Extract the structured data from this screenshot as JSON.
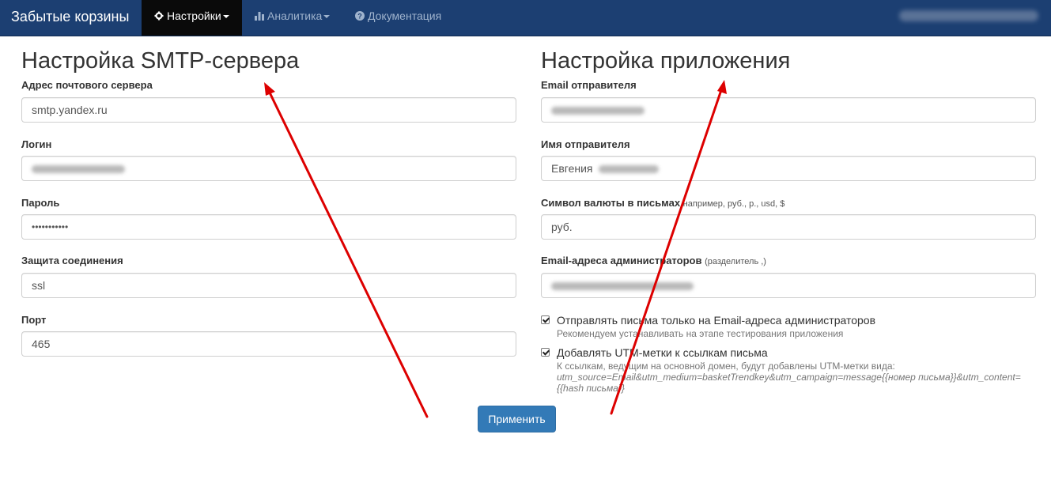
{
  "navbar": {
    "brand": "Забытые корзины",
    "items": [
      {
        "label": "Настройки",
        "icon": "gear-icon",
        "active": true
      },
      {
        "label": "Аналитика",
        "icon": "bar-chart-icon",
        "active": false
      },
      {
        "label": "Документация",
        "icon": "question-circle-icon",
        "active": false
      }
    ]
  },
  "smtp": {
    "title": "Настройка SMTP-сервера",
    "server_label": "Адрес почтового сервера",
    "server_value": "smtp.yandex.ru",
    "login_label": "Логин",
    "password_label": "Пароль",
    "password_value": "•••••••••••",
    "security_label": "Защита соединения",
    "security_value": "ssl",
    "port_label": "Порт",
    "port_value": "465"
  },
  "app": {
    "title": "Настройка приложения",
    "sender_email_label": "Email отправителя",
    "sender_name_label": "Имя отправителя",
    "sender_name_value": "Евгения",
    "currency_label": "Символ валюты в письмах",
    "currency_hint": "например, руб., р., usd, $",
    "currency_value": "руб.",
    "admins_label": "Email-адреса администраторов",
    "admins_hint": "(разделитель ,)",
    "check1_label": "Отправлять письма только на Email-адреса администраторов",
    "check1_note": "Рекомендуем устанавливать на этапе тестирования приложения",
    "check2_label": "Добавлять UTM-метки к ссылкам письма",
    "check2_note": "К ссылкам, ведущим на основной домен, будут добавлены UTM-метки вида:",
    "check2_code1": "utm_source=Email&utm_medium=basketTrendkey&utm_campaign=message{{номер письма}}&utm_content=",
    "check2_code2": "{{hash письма}}"
  },
  "apply_label": "Применить",
  "colors": {
    "navbar": "#1c3f72",
    "active_tab": "#0a0a0a",
    "primary_button": "#337ab7",
    "annotation_arrow": "#dd0000"
  }
}
